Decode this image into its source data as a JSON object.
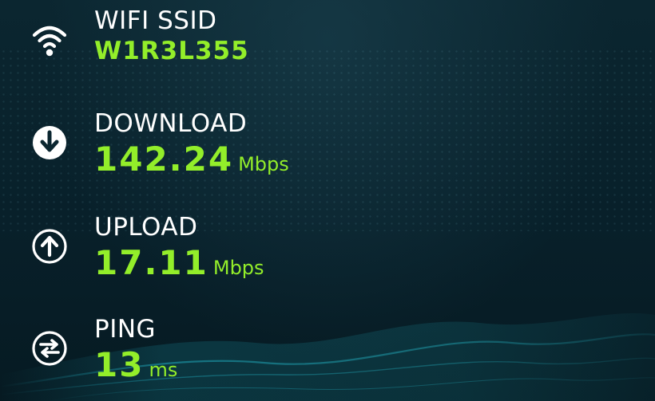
{
  "colors": {
    "accent": "#93ee2a",
    "text": "#ffffff",
    "background": "#081c24"
  },
  "wifi": {
    "label": "WIFI SSID",
    "value": "W1R3L355",
    "icon": "wifi-icon"
  },
  "download": {
    "label": "DOWNLOAD",
    "value": "142.24",
    "unit": "Mbps",
    "icon": "download-arrow-icon"
  },
  "upload": {
    "label": "UPLOAD",
    "value": "17.11",
    "unit": "Mbps",
    "icon": "upload-arrow-icon"
  },
  "ping": {
    "label": "PING",
    "value": "13",
    "unit": "ms",
    "icon": "ping-arrows-icon"
  }
}
